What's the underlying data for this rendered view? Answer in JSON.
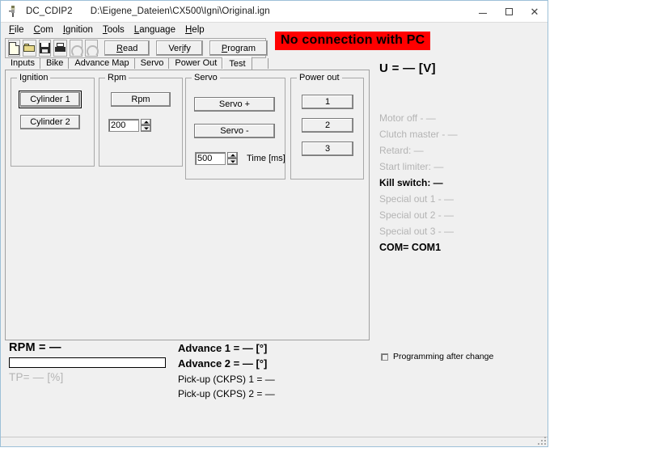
{
  "window": {
    "app_name": "DC_CDIP2",
    "file_path": "D:\\Eigene_Dateien\\CX500\\Igni\\Original.ign",
    "icon": "spark-plug-icon",
    "controls": {
      "minimize": "minimize-icon",
      "maximize": "maximize-icon",
      "close": "close-icon"
    }
  },
  "menu": {
    "items": [
      {
        "label": "File",
        "accel": "F"
      },
      {
        "label": "Com",
        "accel": "C"
      },
      {
        "label": "Ignition",
        "accel": "I"
      },
      {
        "label": "Tools",
        "accel": "T"
      },
      {
        "label": "Language",
        "accel": "L"
      },
      {
        "label": "Help",
        "accel": "H"
      }
    ]
  },
  "toolbar": {
    "icons": [
      {
        "name": "new-file-icon",
        "enabled": true
      },
      {
        "name": "open-folder-icon",
        "enabled": true
      },
      {
        "name": "save-disk-icon",
        "enabled": true
      },
      {
        "name": "print-icon",
        "enabled": true
      },
      {
        "name": "undo-icon",
        "enabled": false
      },
      {
        "name": "redo-icon",
        "enabled": false
      }
    ],
    "read_label": "Read",
    "verify_label": "Verify",
    "program_label": "Program"
  },
  "status_banner": {
    "text": "No connection with PC",
    "bg": "#ff0000",
    "fg": "#000000"
  },
  "tabs": {
    "items": [
      "Inputs",
      "Bike",
      "Advance Map",
      "Servo",
      "Power Out",
      "Test"
    ],
    "selected": "Test"
  },
  "test_panel": {
    "ignition": {
      "title": "Ignition",
      "buttons": [
        "Cylinder 1",
        "Cylinder 2"
      ],
      "focused": "Cylinder 1"
    },
    "rpm": {
      "title": "Rpm",
      "button_label": "Rpm",
      "value": "200"
    },
    "servo": {
      "title": "Servo",
      "plus_label": "Servo +",
      "minus_label": "Servo -",
      "time_value": "500",
      "time_label": "Time [ms]"
    },
    "power_out": {
      "title": "Power out",
      "buttons": [
        "1",
        "2",
        "3"
      ]
    }
  },
  "status_column": {
    "voltage": "U = — [V]",
    "lines": [
      {
        "text": "Motor off - —",
        "state": "disabled"
      },
      {
        "text": "Clutch master - —",
        "state": "disabled"
      },
      {
        "text": "Retard: —",
        "state": "disabled"
      },
      {
        "text": "Start limiter: —",
        "state": "disabled"
      },
      {
        "text": "Kill switch: —",
        "state": "enabled"
      },
      {
        "text": "Special out 1 - —",
        "state": "disabled"
      },
      {
        "text": "Special out 2 - —",
        "state": "disabled"
      },
      {
        "text": "Special out 3 - —",
        "state": "disabled"
      }
    ],
    "com": "COM= COM1"
  },
  "readouts": {
    "rpm_label": "RPM = —",
    "rpm_bar_value": "",
    "tp_label": "TP= — [%]",
    "advance_1": "Advance 1 = — [°]",
    "advance_2": "Advance 2 = — [°]",
    "pickup_1": "Pick-up (CKPS) 1 = —",
    "pickup_2": "Pick-up (CKPS) 2 = —",
    "program_after_change": {
      "label": "Programming after change",
      "checked": false
    }
  }
}
